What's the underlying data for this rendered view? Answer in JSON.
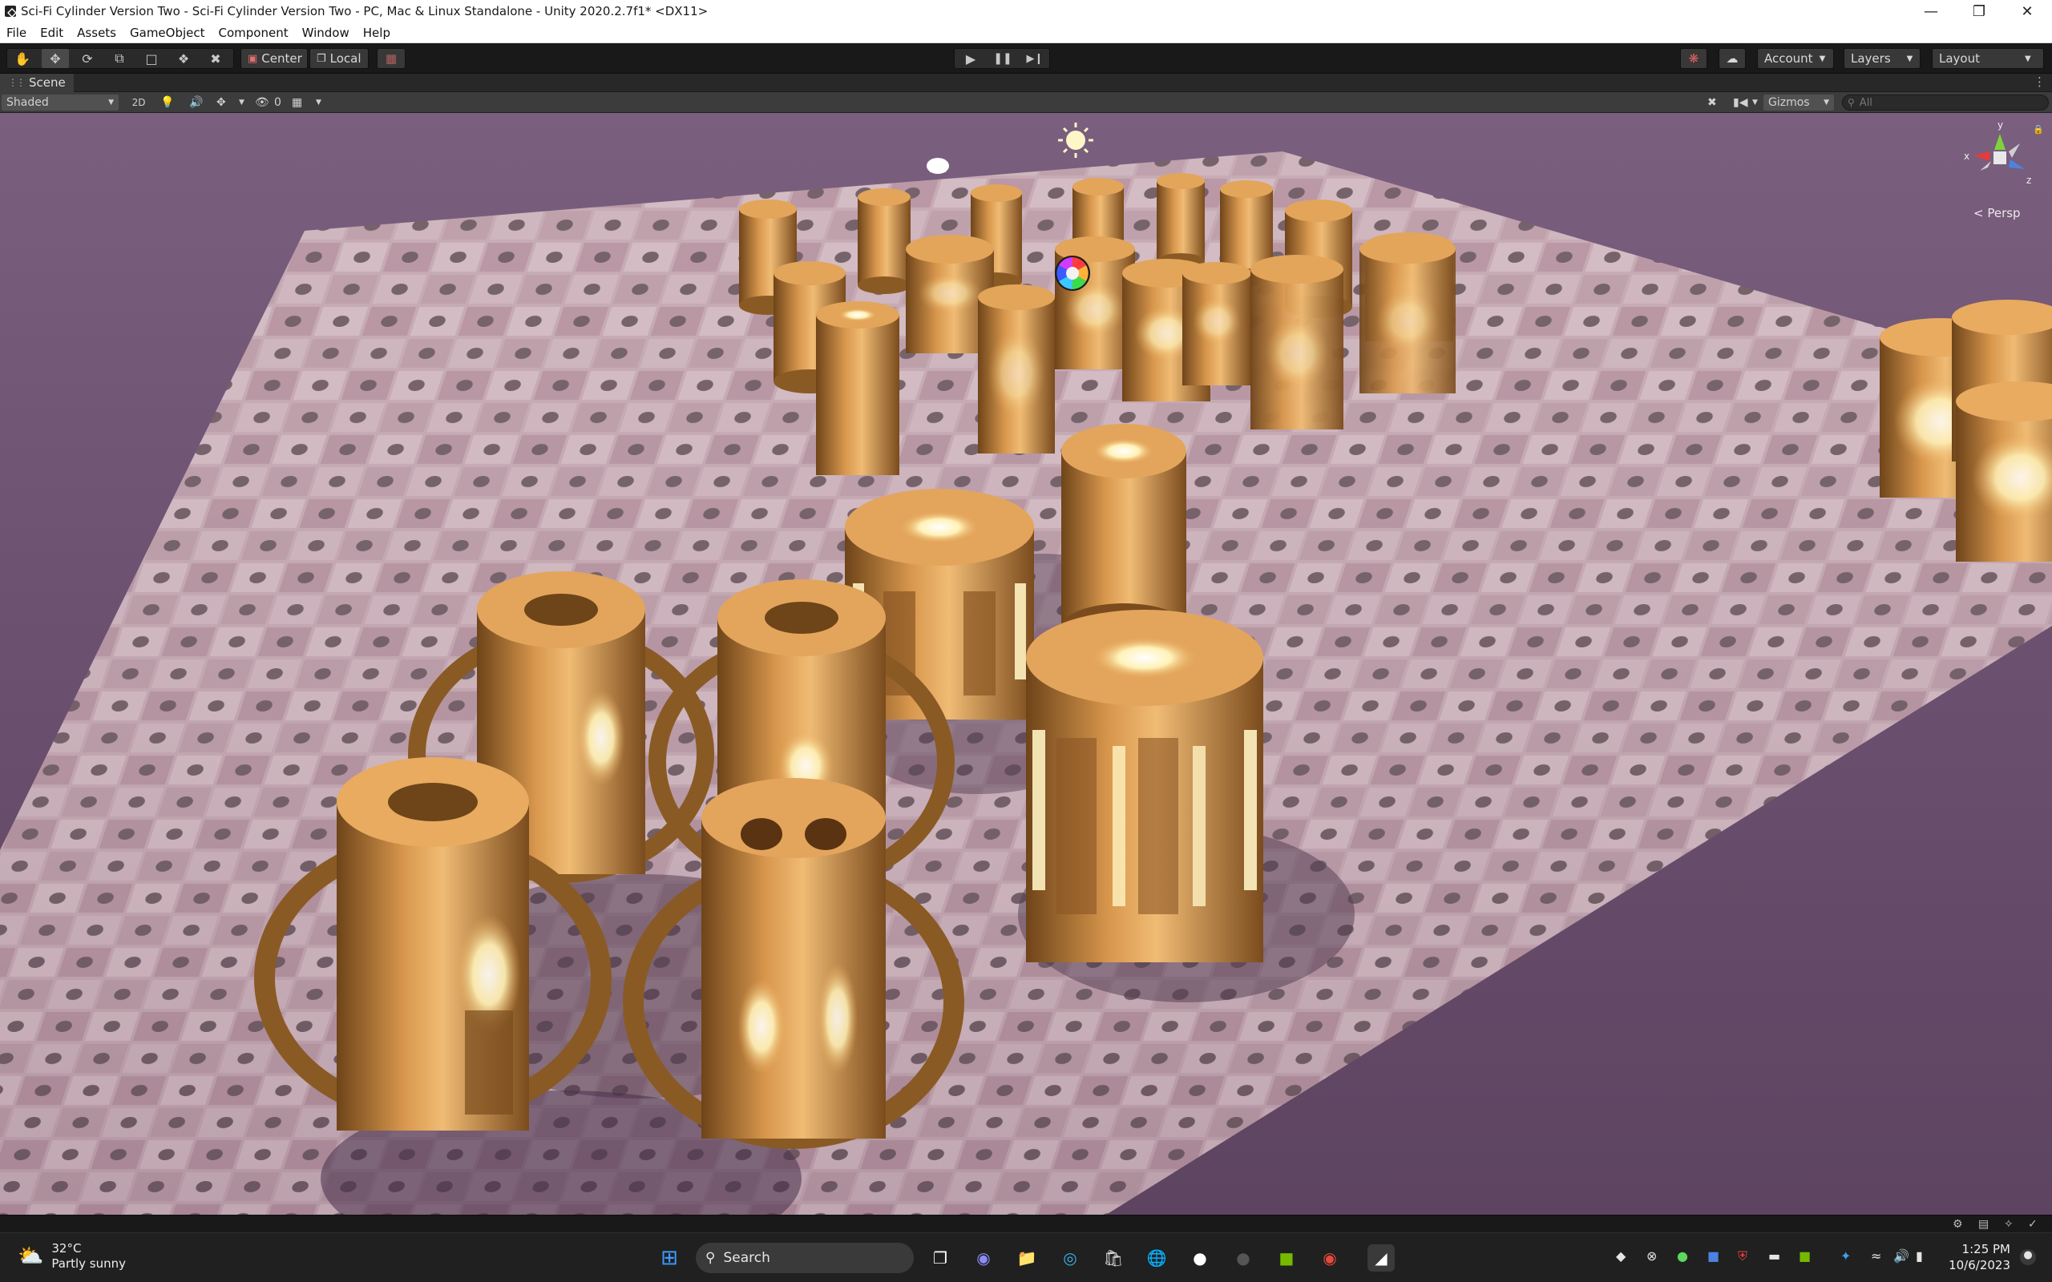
{
  "window": {
    "title": "Sci-Fi Cylinder Version Two - Sci-Fi Cylinder Version Two - PC, Mac & Linux Standalone - Unity 2020.2.7f1* <DX11>",
    "controls": [
      "minimize",
      "restore",
      "close"
    ]
  },
  "menu": [
    "File",
    "Edit",
    "Assets",
    "GameObject",
    "Component",
    "Window",
    "Help"
  ],
  "toolbar": {
    "tools": [
      "hand-tool",
      "move-tool",
      "rotate-tool",
      "scale-tool",
      "rect-tool",
      "transform-tool",
      "custom-tool"
    ],
    "active_tool": "move-tool",
    "pivot_label": "Center",
    "space_label": "Local",
    "play_controls": [
      "play",
      "pause",
      "step"
    ],
    "account_label": "Account",
    "layers_label": "Layers",
    "layout_label": "Layout"
  },
  "scene_tab": {
    "label": "Scene"
  },
  "scene_toolbar": {
    "draw_mode": "Shaded",
    "mode_2d": "2D",
    "hidden_count": "0",
    "gizmos_label": "Gizmos",
    "search_placeholder": "All"
  },
  "viewport": {
    "projection_label": "< Persp",
    "axes": {
      "x": "x",
      "y": "y",
      "z": "z"
    },
    "sky_color": "#6d5171",
    "floor_color": "#b79aa6",
    "object_color": "#c98b43",
    "glow_color": "#fff2b8"
  },
  "taskbar": {
    "weather_temp": "32°C",
    "weather_desc": "Partly sunny",
    "search_label": "Search",
    "time": "1:25 PM",
    "date": "10/6/2023"
  },
  "colors": {
    "editor_bg": "#191919",
    "panel": "#3c3c3c",
    "accent_blue": "#2d7be5"
  }
}
